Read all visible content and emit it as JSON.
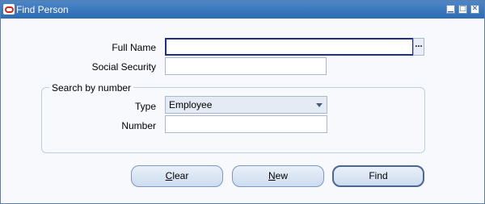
{
  "window": {
    "title": "Find Person",
    "controls": {
      "minimize": "▁",
      "maximize": "□",
      "close": "✕"
    },
    "icon": "oracle-logo-icon"
  },
  "form": {
    "full_name": {
      "label": "Full Name",
      "value": ""
    },
    "lov_button": "...",
    "social_security": {
      "label": "Social Security",
      "value": ""
    },
    "group": {
      "title": "Search by number",
      "type": {
        "label": "Type",
        "selected": "Employee"
      },
      "number": {
        "label": "Number",
        "value": ""
      }
    }
  },
  "buttons": {
    "clear": {
      "mnemonic": "C",
      "rest": "lear"
    },
    "new": {
      "mnemonic": "N",
      "rest": "ew"
    },
    "find": {
      "label": "Find"
    }
  },
  "colors": {
    "titlebar": "#2d6bb3",
    "focus_border": "#1f2f85"
  }
}
